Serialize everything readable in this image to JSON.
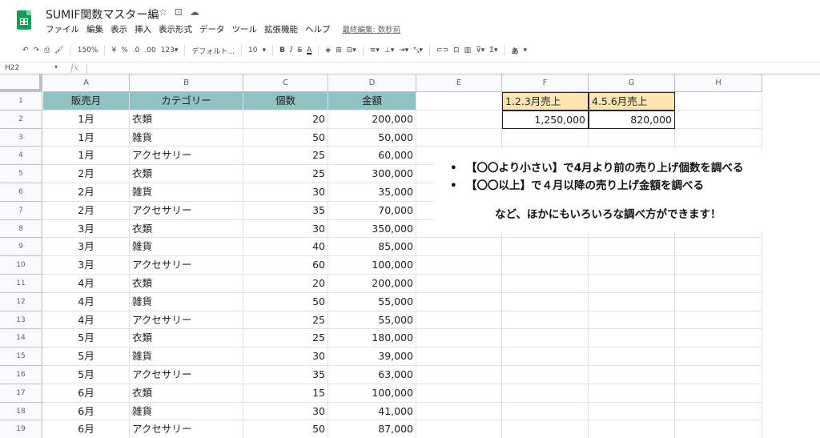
{
  "app": {
    "title": "SUMIF関数マスター編",
    "title_icons": [
      "star-icon",
      "move-to-folder-icon",
      "cloud-status-icon"
    ],
    "menu": [
      "ファイル",
      "編集",
      "表示",
      "挿入",
      "表示形式",
      "データ",
      "ツール",
      "拡張機能",
      "ヘルプ"
    ],
    "last_edit": "最終編集: 数秒前"
  },
  "toolbar": {
    "zoom": "150%",
    "currency": "¥",
    "percent": "%",
    "dec_decrease": ".0",
    "dec_increase": ".00",
    "more_formats": "123▾",
    "font": "デフォルト...",
    "font_size": "10",
    "bold": "B",
    "italic": "I",
    "strike": "S",
    "underline": "A",
    "input_tool": "あ"
  },
  "formula_bar": {
    "cell_ref": "H22",
    "fx": "fx",
    "value": ""
  },
  "columns": [
    "A",
    "B",
    "C",
    "D",
    "E",
    "F",
    "G",
    "H"
  ],
  "rows": [
    "1",
    "2",
    "3",
    "4",
    "5",
    "6",
    "7",
    "8",
    "9",
    "10",
    "11",
    "12",
    "13",
    "14",
    "15",
    "16",
    "17",
    "18",
    "19"
  ],
  "table": {
    "headers": [
      "販売月",
      "カテゴリー",
      "個数",
      "金額"
    ],
    "data": [
      [
        "1月",
        "衣類",
        "20",
        "200,000"
      ],
      [
        "1月",
        "雑貨",
        "50",
        "50,000"
      ],
      [
        "1月",
        "アクセサリー",
        "25",
        "60,000"
      ],
      [
        "2月",
        "衣類",
        "25",
        "300,000"
      ],
      [
        "2月",
        "雑貨",
        "30",
        "35,000"
      ],
      [
        "2月",
        "アクセサリー",
        "35",
        "70,000"
      ],
      [
        "3月",
        "衣類",
        "30",
        "350,000"
      ],
      [
        "3月",
        "雑貨",
        "40",
        "85,000"
      ],
      [
        "3月",
        "アクセサリー",
        "60",
        "100,000"
      ],
      [
        "4月",
        "衣類",
        "20",
        "200,000"
      ],
      [
        "4月",
        "雑貨",
        "50",
        "55,000"
      ],
      [
        "4月",
        "アクセサリー",
        "25",
        "55,000"
      ],
      [
        "5月",
        "衣類",
        "25",
        "180,000"
      ],
      [
        "5月",
        "雑貨",
        "30",
        "39,000"
      ],
      [
        "5月",
        "アクセサリー",
        "35",
        "63,000"
      ],
      [
        "6月",
        "衣類",
        "15",
        "100,000"
      ],
      [
        "6月",
        "雑貨",
        "30",
        "41,000"
      ],
      [
        "6月",
        "アクセサリー",
        "50",
        "87,000"
      ]
    ]
  },
  "summary": {
    "f1": "1.2.3月売上",
    "g1": "4.5.6月売上",
    "f2": "1,250,000",
    "g2": "820,000"
  },
  "callout": {
    "bullet1": "【〇〇より小さい】で4月より前の売り上げ個数を調べる",
    "bullet2": "【〇〇以上】で４月以降の売り上げ金額を調べる",
    "note": "など、ほかにもいろいろな調べ方ができます！"
  },
  "colors": {
    "header_fill": "#8fc2c2",
    "summary_fill": "#fce5b0",
    "brand_green": "#0f9d58"
  }
}
